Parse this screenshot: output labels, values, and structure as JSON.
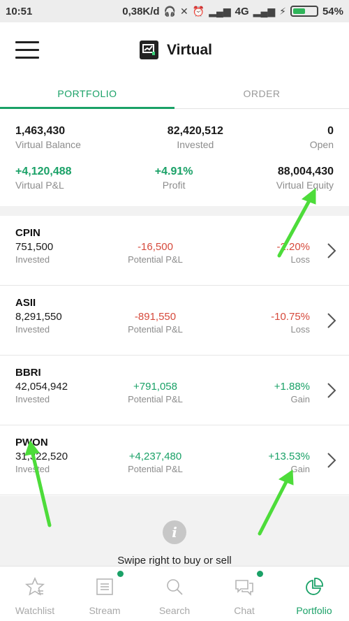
{
  "status_bar": {
    "time": "10:51",
    "net_speed": "0,38K/d",
    "network": "4G",
    "battery": "54%",
    "battery_level": 0.54
  },
  "app_bar": {
    "title": "Virtual"
  },
  "tabs": [
    {
      "label": "PORTFOLIO",
      "active": true
    },
    {
      "label": "ORDER",
      "active": false
    }
  ],
  "summary": {
    "virtual_balance": {
      "value": "1,463,430",
      "label": "Virtual Balance"
    },
    "invested": {
      "value": "82,420,512",
      "label": "Invested"
    },
    "open": {
      "value": "0",
      "label": "Open"
    },
    "virtual_pnl": {
      "value": "+4,120,488",
      "label": "Virtual P&L"
    },
    "profit": {
      "value": "+4.91%",
      "label": "Profit"
    },
    "virtual_equity": {
      "value": "88,004,430",
      "label": "Virtual Equity"
    }
  },
  "stocks": [
    {
      "ticker": "CPIN",
      "invested": "751,500",
      "invested_label": "Invested",
      "pnl": "-16,500",
      "pnl_label": "Potential P&L",
      "pct": "-2.20%",
      "status": "Loss"
    },
    {
      "ticker": "ASII",
      "invested": "8,291,550",
      "invested_label": "Invested",
      "pnl": "-891,550",
      "pnl_label": "Potential P&L",
      "pct": "-10.75%",
      "status": "Loss"
    },
    {
      "ticker": "BBRI",
      "invested": "42,054,942",
      "invested_label": "Invested",
      "pnl": "+791,058",
      "pnl_label": "Potential P&L",
      "pct": "+1.88%",
      "status": "Gain"
    },
    {
      "ticker": "PWON",
      "invested": "31,322,520",
      "invested_label": "Invested",
      "pnl": "+4,237,480",
      "pnl_label": "Potential P&L",
      "pct": "+13.53%",
      "status": "Gain"
    }
  ],
  "hint": {
    "text": "Swipe right to buy or sell"
  },
  "bottom_nav": [
    {
      "label": "Watchlist",
      "icon": "star-icon",
      "active": false
    },
    {
      "label": "Stream",
      "icon": "stream-icon",
      "active": false,
      "dot": true
    },
    {
      "label": "Search",
      "icon": "search-icon",
      "active": false
    },
    {
      "label": "Chat",
      "icon": "chat-icon",
      "active": false,
      "dot": true
    },
    {
      "label": "Portfolio",
      "icon": "pie-chart-icon",
      "active": true
    }
  ],
  "colors": {
    "accent": "#1aa167",
    "loss": "#d64a3c",
    "annotation_arrow": "#4ddc3a"
  }
}
